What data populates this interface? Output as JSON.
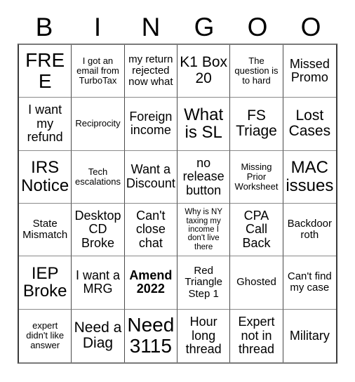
{
  "card": {
    "header_letters": [
      "B",
      "I",
      "N",
      "G",
      "O",
      "O"
    ],
    "columns": 6,
    "rows": 6,
    "colors": {
      "background": "#ffffff",
      "text": "#000000",
      "grid_line": "#4a4a4a"
    },
    "cells": [
      {
        "text": "FREE",
        "size": "xxl",
        "marked": false
      },
      {
        "text": "I got an email from TurboTax",
        "size": "xs",
        "marked": false
      },
      {
        "text": "my return rejected now what",
        "size": "sm",
        "marked": false
      },
      {
        "text": "K1 Box 20",
        "size": "lg",
        "marked": false
      },
      {
        "text": "The question is to hard",
        "size": "xs",
        "marked": false
      },
      {
        "text": "Missed Promo",
        "size": "md",
        "marked": false
      },
      {
        "text": "I want my refund",
        "size": "md",
        "marked": false
      },
      {
        "text": "Reciprocity",
        "size": "xs",
        "marked": false
      },
      {
        "text": "Foreign income",
        "size": "md",
        "marked": false
      },
      {
        "text": "What is SL",
        "size": "xl",
        "marked": false
      },
      {
        "text": "FS Triage",
        "size": "lg",
        "marked": false
      },
      {
        "text": "Lost Cases",
        "size": "lg",
        "marked": false
      },
      {
        "text": "IRS Notice",
        "size": "xl",
        "marked": false
      },
      {
        "text": "Tech escalations",
        "size": "xs",
        "marked": false
      },
      {
        "text": "Want a Discount",
        "size": "md",
        "marked": false
      },
      {
        "text": "no release button",
        "size": "md",
        "marked": false
      },
      {
        "text": "Missing Prior Worksheet",
        "size": "xs",
        "marked": false
      },
      {
        "text": "MAC issues",
        "size": "xl",
        "marked": false
      },
      {
        "text": "State Mismatch",
        "size": "sm",
        "marked": false
      },
      {
        "text": "Desktop CD Broke",
        "size": "md",
        "marked": false
      },
      {
        "text": "Can't close chat",
        "size": "md",
        "marked": false
      },
      {
        "text": "Why is NY taxing my income I don't live there",
        "size": "xxs",
        "marked": false
      },
      {
        "text": "CPA Call Back",
        "size": "md",
        "marked": false
      },
      {
        "text": "Backdoor roth",
        "size": "sm",
        "marked": false
      },
      {
        "text": "IEP Broke",
        "size": "xl",
        "marked": false
      },
      {
        "text": "I want a MRG",
        "size": "md",
        "marked": false
      },
      {
        "text": "Amend 2022",
        "size": "md",
        "marked": true
      },
      {
        "text": "Red Triangle Step 1",
        "size": "sm",
        "marked": false
      },
      {
        "text": "Ghosted",
        "size": "sm",
        "marked": false
      },
      {
        "text": "Can't find my case",
        "size": "sm",
        "marked": false
      },
      {
        "text": "expert didn't like answer",
        "size": "xs",
        "marked": false
      },
      {
        "text": "Need a Diag",
        "size": "lg",
        "marked": false
      },
      {
        "text": "Need 3115",
        "size": "xxl",
        "marked": false
      },
      {
        "text": "Hour long thread",
        "size": "md",
        "marked": false
      },
      {
        "text": "Expert not in thread",
        "size": "md",
        "marked": false
      },
      {
        "text": "Military",
        "size": "md",
        "marked": false
      }
    ]
  }
}
